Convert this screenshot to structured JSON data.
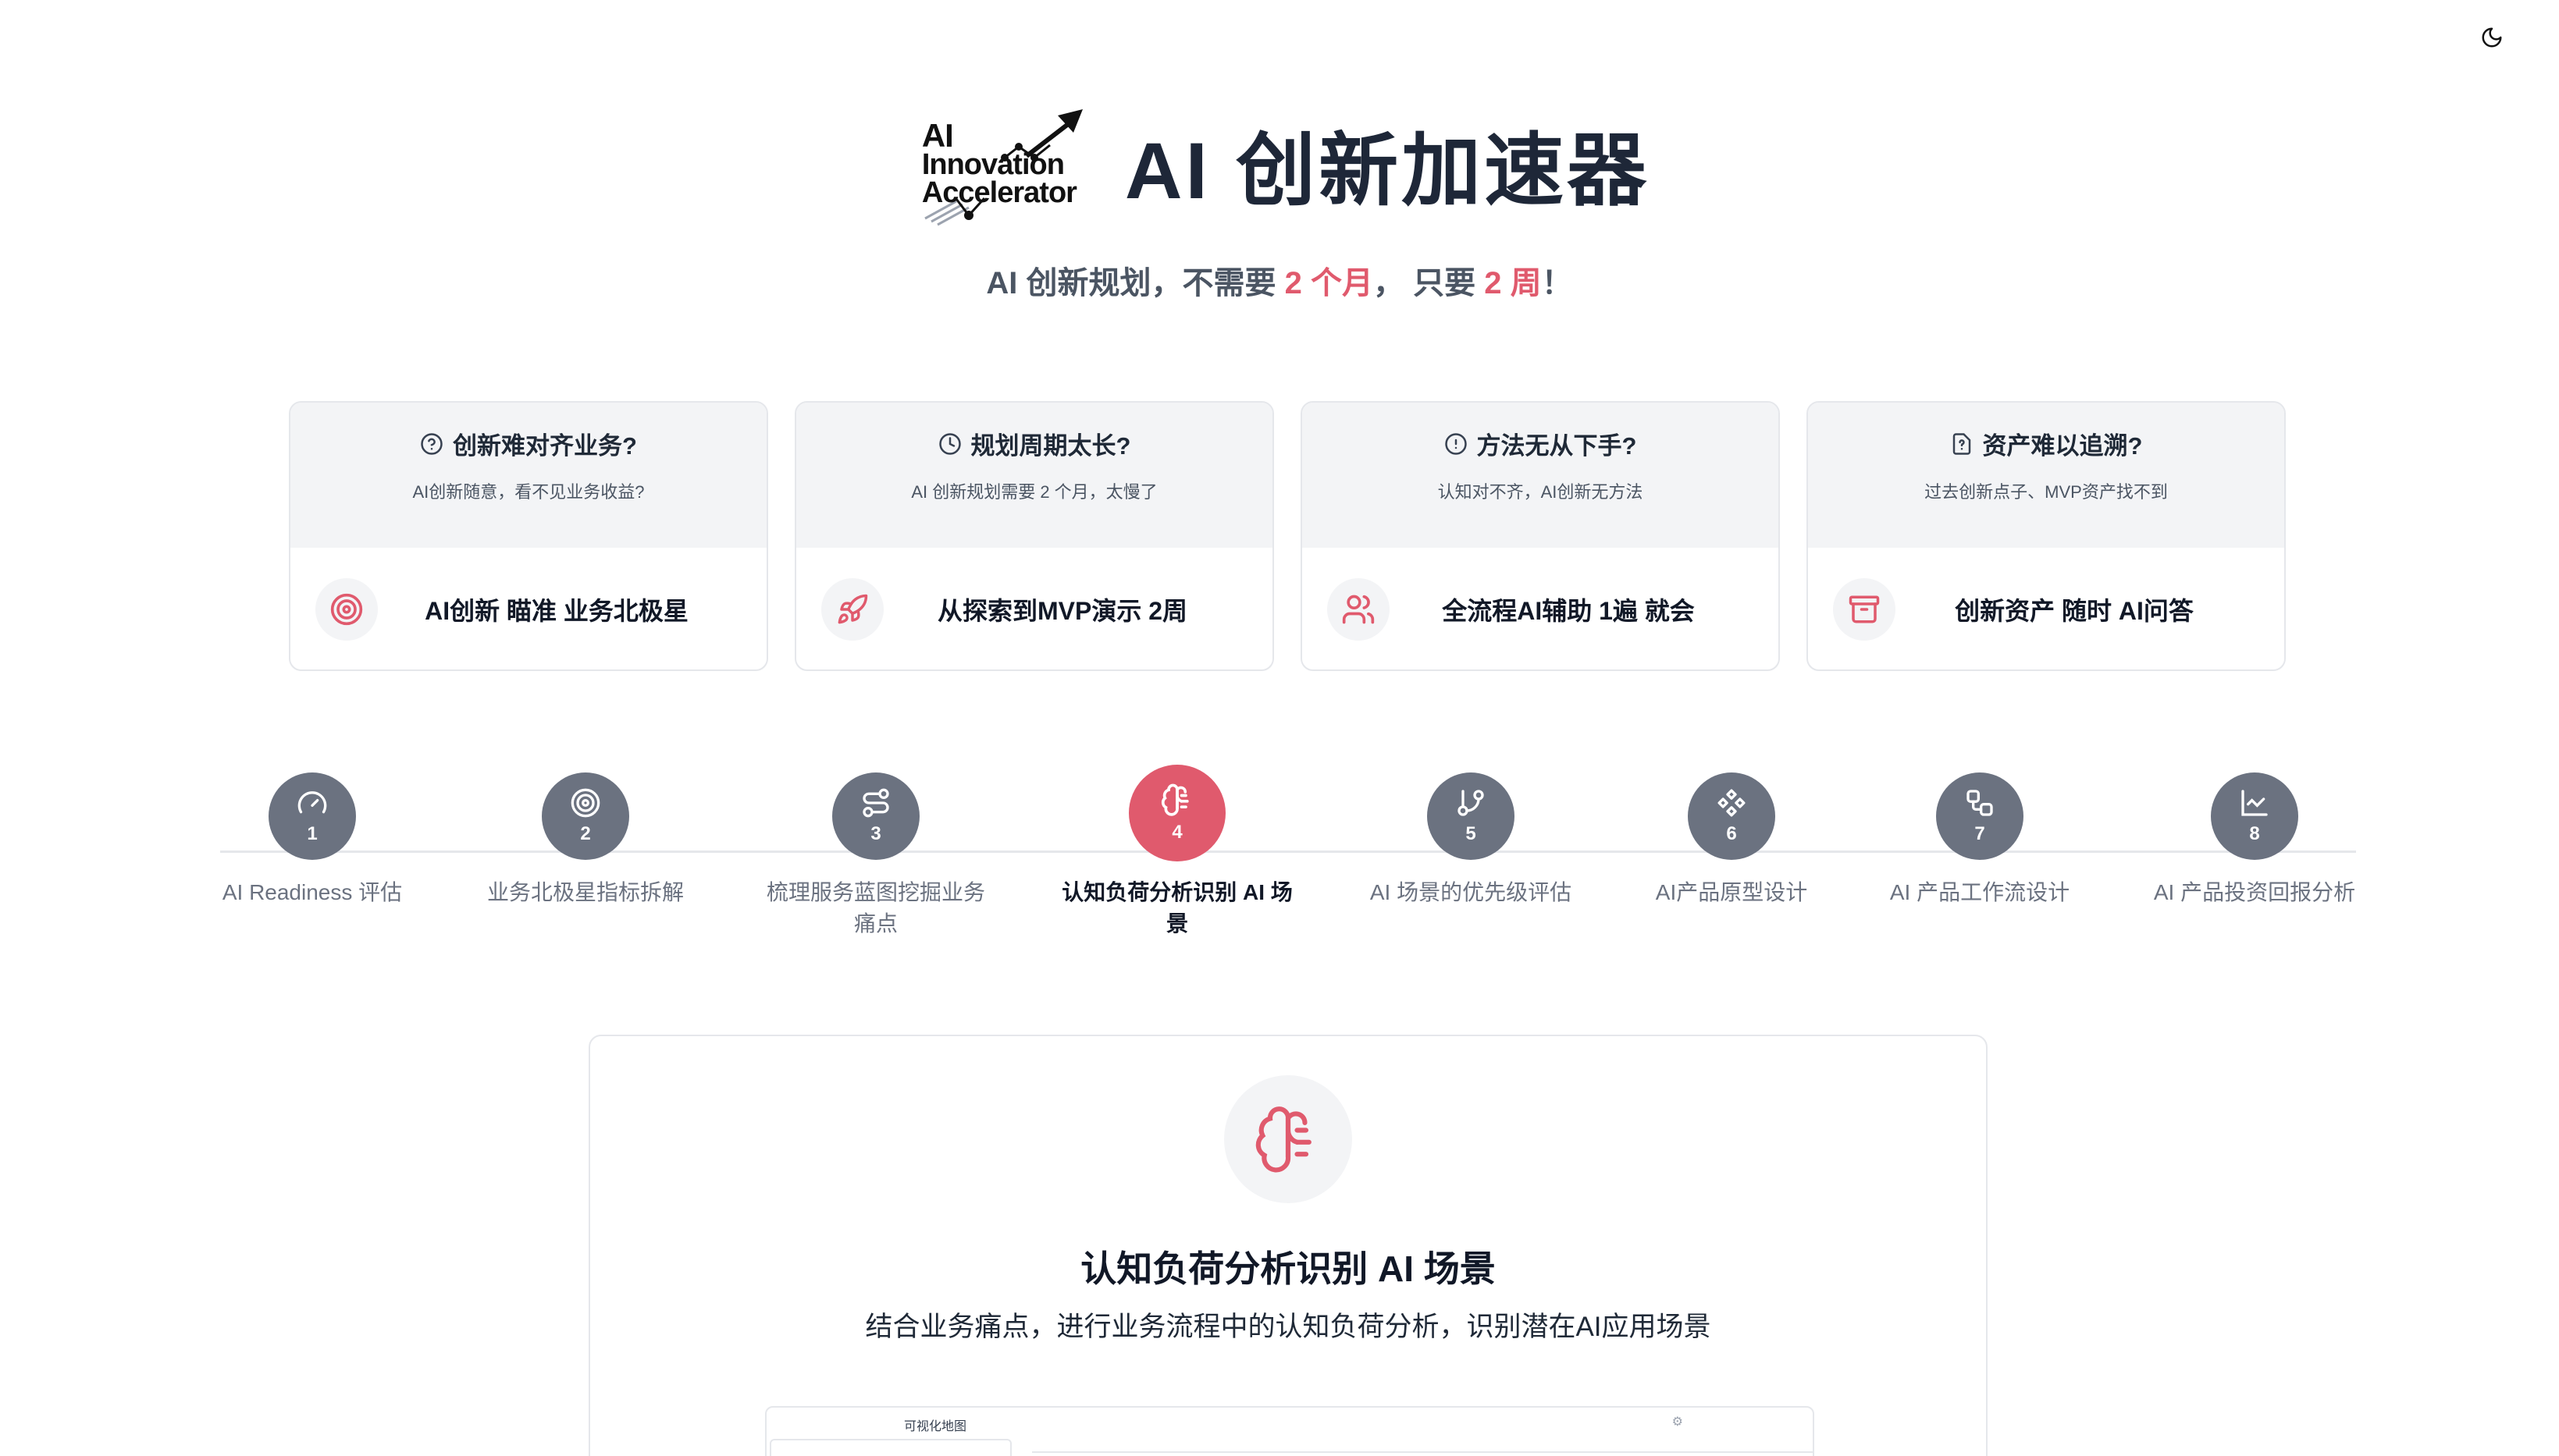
{
  "topbar": {
    "theme_icon": "moon-icon"
  },
  "logo": {
    "line1": "AI",
    "line2": "Innovation",
    "line3": "Accelerator"
  },
  "hero": {
    "title": "AI 创新加速器",
    "subtitle_pre": "AI 创新规划，不需要 ",
    "subtitle_hl1": "2 个月",
    "subtitle_mid": "， 只要 ",
    "subtitle_hl2": "2 周",
    "subtitle_post": "！"
  },
  "colors": {
    "accent": "#e05a6d",
    "step_inactive": "#6b7280",
    "title": "#1e2738"
  },
  "cards": [
    {
      "question": "创新难对齐业务?",
      "question_icon": "help-circle-icon",
      "sub": "AI创新随意，看不见业务收益?",
      "answer": "AI创新 瞄准 业务北极星",
      "answer_icon": "target-icon"
    },
    {
      "question": "规划周期太长?",
      "question_icon": "clock-icon",
      "sub": "AI 创新规划需要 2 个月，太慢了",
      "answer": "从探索到MVP演示 2周",
      "answer_icon": "rocket-icon"
    },
    {
      "question": "方法无从下手?",
      "question_icon": "alert-circle-icon",
      "sub": "认知对不齐，AI创新无方法",
      "answer": "全流程AI辅助 1遍 就会",
      "answer_icon": "users-icon"
    },
    {
      "question": "资产难以追溯?",
      "question_icon": "file-question-icon",
      "sub": "过去创新点子、MVP资产找不到",
      "answer": "创新资产 随时 AI问答",
      "answer_icon": "archive-icon"
    }
  ],
  "steps": [
    {
      "num": "1",
      "label": "AI Readiness 评估",
      "icon": "gauge-icon"
    },
    {
      "num": "2",
      "label": "业务北极星指标拆解",
      "icon": "target-icon"
    },
    {
      "num": "3",
      "label": "梳理服务蓝图挖掘业务痛点",
      "icon": "route-icon"
    },
    {
      "num": "4",
      "label": "认知负荷分析识别 AI 场景",
      "icon": "brain-icon",
      "active": true
    },
    {
      "num": "5",
      "label": "AI 场景的优先级评估",
      "icon": "git-branch-icon"
    },
    {
      "num": "6",
      "label": "AI产品原型设计",
      "icon": "component-icon"
    },
    {
      "num": "7",
      "label": "AI 产品工作流设计",
      "icon": "workflow-icon"
    },
    {
      "num": "8",
      "label": "AI 产品投资回报分析",
      "icon": "line-chart-icon"
    }
  ],
  "detail": {
    "icon": "brain-icon",
    "title": "认知负荷分析识别 AI 场景",
    "description": "结合业务痛点，进行业务流程中的认知负荷分析，识别潜在AI应用场景",
    "preview_title": "可视化地图",
    "preview_icon": "gear-icon"
  }
}
